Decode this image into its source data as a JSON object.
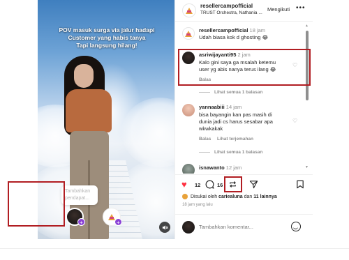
{
  "video": {
    "caption_line1": "POV masuk surga via jalur hadapi",
    "caption_line2": "Customer yang habis tanya",
    "caption_line3": "Tapi langsung hilang!",
    "popup_line1": "Tambahkan",
    "popup_line2": "pendapat..."
  },
  "header": {
    "username": "resellercampofficial",
    "subtitle": "TRUST Orchestra, Nathania ...",
    "follow_label": "Mengikuti",
    "more_label": "•••"
  },
  "comments": [
    {
      "username": "resellercampofficial",
      "time": "18 jam",
      "text": "Udah biasa kok d ghosting 😂"
    },
    {
      "username": "asriwijayanti95",
      "time": "2 jam",
      "text1": "Kalo gini saya ga msalah ketemu",
      "text2": "user yg abis nanya terus ilang 😂",
      "reply": "Balas",
      "view_replies": "Lihat semua 1 balasan"
    },
    {
      "username": "yannaabiii",
      "time": "14 jam",
      "text1": "bisa bayangin kan pas masih di",
      "text2": "dunia jadi cs harus sesabar apa",
      "text3": "wkwkakak",
      "reply": "Balas",
      "translate": "Lihat terjemahan",
      "view_replies": "Lihat semua 1 balasan"
    },
    {
      "username": "isnawanto",
      "time": "12 jam"
    }
  ],
  "actions": {
    "likes": "12",
    "comments_count": "16",
    "liked_by_prefix": "Disukai oleh",
    "liked_by_user": "cariealuna",
    "liked_by_join": "dan",
    "liked_by_others": "11 lainnya",
    "date": "18 jam yang lalu"
  },
  "add_comment": {
    "placeholder": "Tambahkan komentar..."
  },
  "colors": {
    "like_red": "#ff3040",
    "annotation_red": "#b11d22",
    "badge_purple": "#8b43d6"
  }
}
